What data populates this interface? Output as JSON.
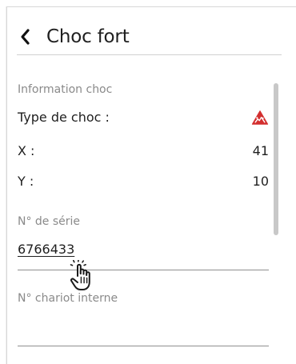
{
  "header": {
    "title": "Choc fort"
  },
  "section": {
    "label": "Information choc"
  },
  "shock": {
    "type_label": "Type de choc :",
    "warning_icon": "warning-triangle-icon",
    "warning_color": "#d32f2f",
    "x_label": "X :",
    "x_value": "41",
    "y_label": "Y :",
    "y_value": "10"
  },
  "serial": {
    "label": "N° de série",
    "value": "6766433"
  },
  "internal_cart": {
    "label": "N° chariot interne",
    "value": ""
  },
  "icons": {
    "back": "chevron-left-icon",
    "cursor": "hand-pointer-icon"
  }
}
